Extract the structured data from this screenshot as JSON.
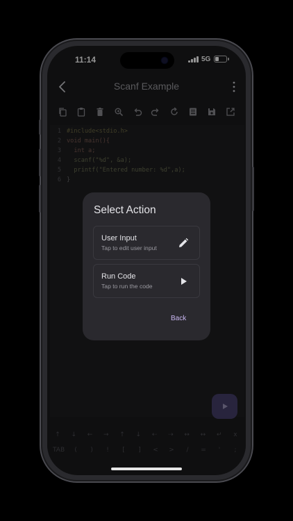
{
  "status": {
    "time": "11:14",
    "network": "5G",
    "battery_level": 0.35,
    "signal_bars": 4
  },
  "app_bar": {
    "title": "Scanf Example"
  },
  "toolbar": {
    "icons": [
      "copy-icon",
      "paste-icon",
      "delete-icon",
      "find-replace-icon",
      "undo-icon",
      "redo-icon",
      "refresh-icon",
      "file-list-icon",
      "save-icon",
      "open-external-icon"
    ]
  },
  "editor": {
    "lines": [
      {
        "n": "1",
        "t": "#include<stdio.h>"
      },
      {
        "n": "2",
        "t": "void main(){"
      },
      {
        "n": "3",
        "t": "  int a;"
      },
      {
        "n": "4",
        "t": "  scanf(\"%d\", &a);"
      },
      {
        "n": "5",
        "t": "  printf(\"Entered number: %d\",a);"
      },
      {
        "n": "6",
        "t": "}"
      }
    ]
  },
  "dialog": {
    "title": "Select Action",
    "actions": [
      {
        "title": "User Input",
        "subtitle": "Tap to edit user input",
        "icon": "pencil-icon"
      },
      {
        "title": "Run Code",
        "subtitle": "Tap to run the code",
        "icon": "play-icon"
      }
    ],
    "back_label": "Back"
  },
  "keyboard_bar": {
    "row1": [
      "↑",
      "↓",
      "←",
      "→",
      "↑",
      "↓",
      "⇠",
      "⇢",
      "↔",
      "↔",
      "↵",
      "x"
    ],
    "row2": [
      "TAB",
      "(",
      ")",
      "!",
      "[",
      "]",
      "<",
      ">",
      "/",
      "=",
      "'",
      ";"
    ]
  },
  "colors": {
    "background": "#1b1b1d",
    "dialog": "#2a292e",
    "accent": "#c8b6f0",
    "fab": "#463e6a"
  }
}
